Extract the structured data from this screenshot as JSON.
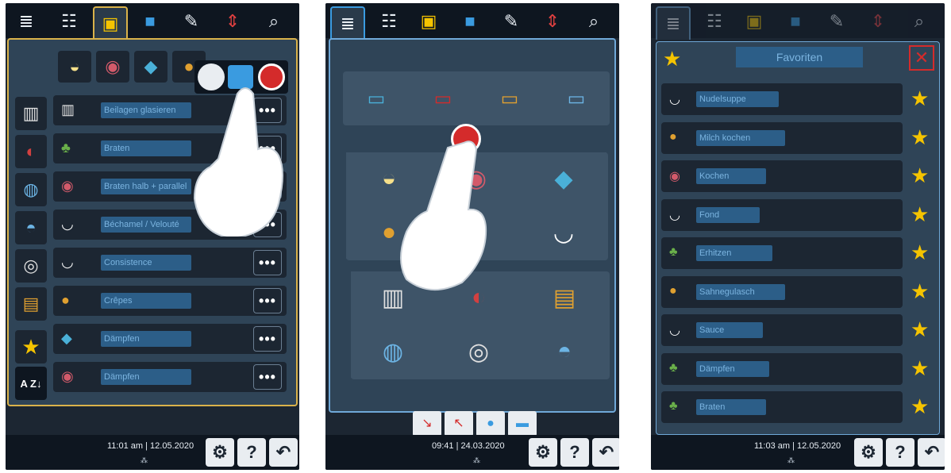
{
  "panel1": {
    "time": "11:01 am",
    "date": "12.05.2020",
    "icons": [
      "menu-icon",
      "sliders-icon",
      "chef-hat-icon",
      "program-icon",
      "edit-icon",
      "zoom-icon",
      "search-icon"
    ],
    "categories": [
      "egg-icon",
      "meat-icon",
      "fish-icon",
      "dessert-icon",
      "vegetable-icon",
      "soup-icon"
    ],
    "popup": [
      "clock-play-icon",
      "list-icon",
      "record-icon"
    ],
    "items": [
      {
        "label": "Beilagen glasieren"
      },
      {
        "label": "Braten"
      },
      {
        "label": "Braten halb + parallel"
      },
      {
        "label": "Béchamel / Velouté"
      },
      {
        "label": "Consistence"
      },
      {
        "label": "Crêpes"
      },
      {
        "label": "Dämpfen"
      },
      {
        "label": "Dämpfen"
      }
    ],
    "more_label": "•••",
    "sort_label": "A Z↓"
  },
  "panel2": {
    "time": "09:41",
    "date": "24.03.2020",
    "methods": [
      "steam-icon",
      "grill-icon",
      "bake-icon",
      "finishing-icon"
    ],
    "foods": [
      "egg-icon",
      "meat-icon",
      "fish-icon",
      "dessert-icon",
      "vegetable-icon",
      "soup-icon"
    ],
    "devices": [
      "griddle-icon",
      "pan-icon",
      "fryer-icon",
      "pot-icon",
      "kettle-icon",
      "pressure-pot-icon"
    ],
    "bottom_icons": [
      "fill-icon",
      "drain-icon",
      "water-icon",
      "water-in-icon"
    ]
  },
  "panel3": {
    "time": "11:03 am",
    "date": "12.05.2020",
    "title": "Favoriten",
    "close_label": "✕",
    "favorites": [
      {
        "label": "Nudelsuppe",
        "icon": "soup"
      },
      {
        "label": "Milch kochen",
        "icon": "dessert"
      },
      {
        "label": "Kochen",
        "icon": "meat"
      },
      {
        "label": "Fond",
        "icon": "soup"
      },
      {
        "label": "Erhitzen",
        "icon": "vegetable"
      },
      {
        "label": "Sahnegulasch",
        "icon": "dessert"
      },
      {
        "label": "Sauce",
        "icon": "soup"
      },
      {
        "label": "Dämpfen",
        "icon": "vegetable"
      },
      {
        "label": "Braten",
        "icon": "vegetable"
      }
    ]
  },
  "colors": {
    "accent": "#d9b24a",
    "star": "#f5c400",
    "close": "#d42b2b",
    "pill": "#2c5e88"
  }
}
